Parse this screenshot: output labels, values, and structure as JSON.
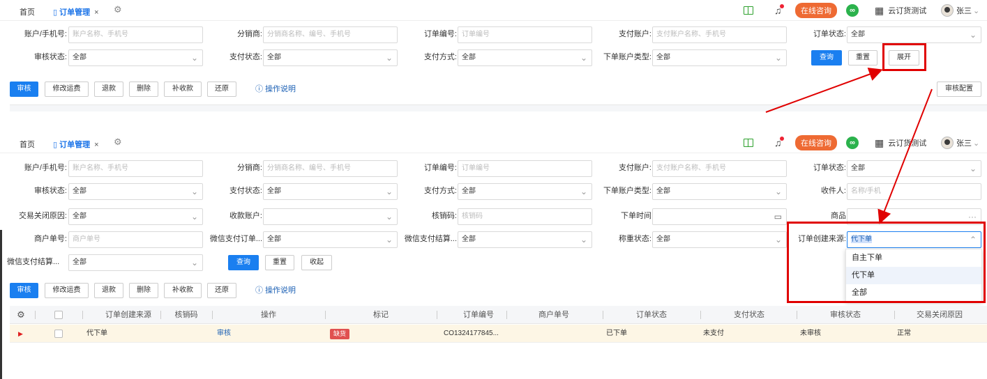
{
  "tabs": {
    "home": "首页",
    "order": "订单管理",
    "close": "×"
  },
  "header": {
    "consult": "在线咨询",
    "company": "云订货测试",
    "user": "张三"
  },
  "icons": {
    "gear": "gear-icon",
    "file": "file-icon",
    "book": "book-icon",
    "bell": "bell-icon",
    "link": "link-icon",
    "building": "building-icon",
    "avatar": "avatar-icon"
  },
  "filters": {
    "account": {
      "label": "账户/手机号:",
      "placeholder": "账户名称、手机号"
    },
    "distributor": {
      "label": "分销商:",
      "placeholder": "分销商名称、编号、手机号"
    },
    "order_no": {
      "label": "订单编号:",
      "placeholder": "订单编号"
    },
    "pay_account": {
      "label": "支付账户:",
      "placeholder": "支付账户名称、手机号"
    },
    "order_status": {
      "label": "订单状态:",
      "value": "全部"
    },
    "audit_status": {
      "label": "审核状态:",
      "value": "全部"
    },
    "pay_status": {
      "label": "支付状态:",
      "value": "全部"
    },
    "pay_method": {
      "label": "支付方式:",
      "value": "全部"
    },
    "order_account_type": {
      "label": "下单账户类型:",
      "value": "全部"
    },
    "receiver": {
      "label": "收件人:",
      "placeholder": "名称/手机"
    },
    "close_reason": {
      "label": "交易关闭原因:",
      "value": "全部"
    },
    "collect_account": {
      "label": "收款账户:",
      "value": ""
    },
    "verify_code": {
      "label": "核销码:",
      "placeholder": "核销码"
    },
    "order_time": {
      "label": "下单时间",
      "value": ""
    },
    "goods": {
      "label": "商品",
      "value": ""
    },
    "merchant_no": {
      "label": "商户单号:",
      "placeholder": "商户单号"
    },
    "wx_order": {
      "label": "微信支付订单...",
      "value": "全部"
    },
    "wx_settle": {
      "label": "微信支付结算...",
      "value": "全部"
    },
    "weigh_status": {
      "label": "称重状态:",
      "value": "全部"
    },
    "create_source": {
      "label": "订单创建来源:",
      "value": "代下单"
    },
    "wx_settle2": {
      "label": "微信支付结算...",
      "value": "全部"
    }
  },
  "buttons": {
    "query": "查询",
    "reset": "重置",
    "expand": "展开",
    "collapse": "收起",
    "audit_config": "审核配置"
  },
  "actions": {
    "audit": "审核",
    "edit_freight": "修改运费",
    "refund": "退款",
    "delete": "删除",
    "supplement": "补收款",
    "restore": "还原",
    "help": "操作说明"
  },
  "dropdown": {
    "options": [
      "自主下单",
      "代下单",
      "全部"
    ],
    "selected": "代下单"
  },
  "table": {
    "headers": [
      "订单创建来源",
      "核销码",
      "操作",
      "标记",
      "订单编号",
      "商户单号",
      "订单状态",
      "支付状态",
      "审核状态",
      "交易关闭原因"
    ],
    "row": {
      "source": "代下单",
      "action": "审核",
      "mark": "缺货",
      "order_no": "CO1324177845...",
      "order_status": "已下单",
      "pay_status": "未支付",
      "audit_status": "未审核",
      "close_reason": "正常"
    }
  }
}
